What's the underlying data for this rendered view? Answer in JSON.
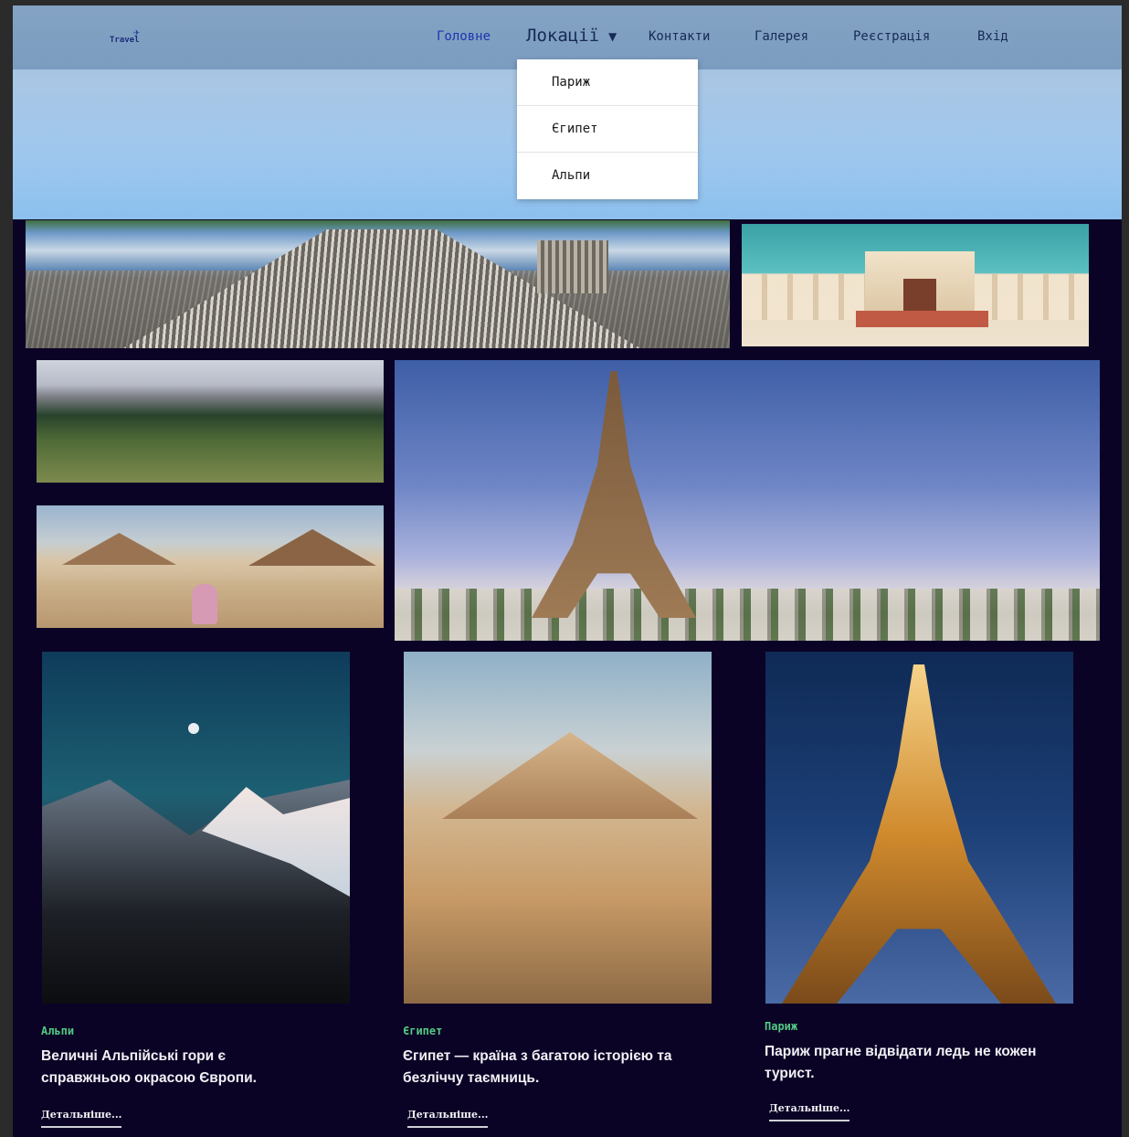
{
  "logo": {
    "text": "Travel"
  },
  "nav": {
    "items": [
      {
        "label": "Головне",
        "active": true
      },
      {
        "label": "Локації",
        "has_dropdown": true
      },
      {
        "label": "Контакти"
      },
      {
        "label": "Галерея"
      },
      {
        "label": "Реєстрація"
      },
      {
        "label": "Вхід"
      }
    ],
    "dropdown": [
      "Париж",
      "Єгипет",
      "Альпи"
    ]
  },
  "cards": [
    {
      "tag": "Альпи",
      "title": "Величні Альпійські гори є справжньою окрасою Європи.",
      "link": "Детальніше..."
    },
    {
      "tag": "Єгипет",
      "title": "Єгипет — країна з багатою історією та безліччу таємниць.",
      "link": "Детальніше..."
    },
    {
      "tag": "Париж",
      "title": "Париж прагне відвідати ледь не кожен турист.",
      "link": "Детальніше..."
    }
  ],
  "colors": {
    "accent": "#52c982",
    "background": "#0b0326",
    "nav_active": "#1d34b0"
  }
}
